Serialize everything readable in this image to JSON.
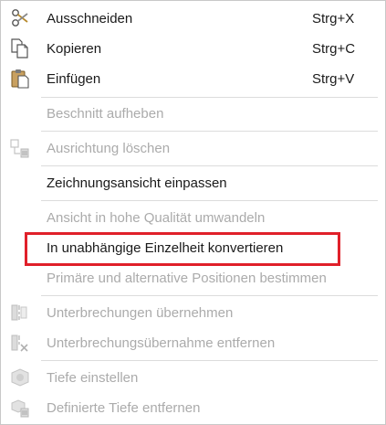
{
  "menu": {
    "items": [
      {
        "label": "Ausschneiden",
        "shortcut": "Strg+X",
        "icon": "scissors-icon"
      },
      {
        "label": "Kopieren",
        "shortcut": "Strg+C",
        "icon": "copy-icon"
      },
      {
        "label": "Einfügen",
        "shortcut": "Strg+V",
        "icon": "clipboard-icon"
      },
      {
        "label": "Beschnitt aufheben"
      },
      {
        "label": "Ausrichtung löschen",
        "icon": "delete-alignment-icon"
      },
      {
        "label": "Zeichnungsansicht einpassen"
      },
      {
        "label": "Ansicht in hohe Qualität umwandeln"
      },
      {
        "label": "In unabhängige Einzelheit konvertieren"
      },
      {
        "label": "Primäre und alternative Positionen bestimmen"
      },
      {
        "label": "Unterbrechungen übernehmen",
        "icon": "break-icon"
      },
      {
        "label": "Unterbrechungsübernahme entfernen",
        "icon": "remove-break-icon"
      },
      {
        "label": "Tiefe einstellen",
        "icon": "depth-icon"
      },
      {
        "label": "Definierte Tiefe entfernen",
        "icon": "remove-depth-icon"
      }
    ]
  },
  "colors": {
    "enabled_text": "#1a1a1a",
    "disabled_text": "#ababab",
    "highlight_border": "#e0202a",
    "separator": "#dcdcdc"
  }
}
